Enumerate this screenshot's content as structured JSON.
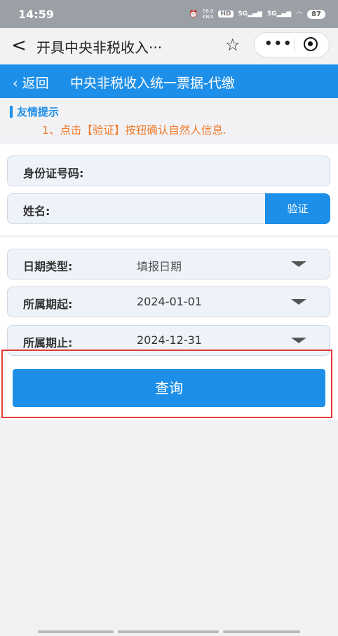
{
  "status": {
    "time": "14:59",
    "net_speed": "56.0",
    "net_unit": "KB/s",
    "hd": "HD",
    "sim1": "5G",
    "sim2": "5G",
    "battery": "87"
  },
  "appbar": {
    "title": "开具中央非税收入···"
  },
  "page_header": {
    "back_label": "返回",
    "title": "中央非税收入统一票据-代缴"
  },
  "tips": {
    "title": "友情提示",
    "text": "1、点击【验证】按钮确认自然人信息."
  },
  "form": {
    "id_label": "身份证号码:",
    "name_label": "姓名:",
    "verify_label": "验证",
    "date_type_label": "日期类型:",
    "date_type_value": "填报日期",
    "start_label": "所属期起:",
    "start_value": "2024-01-01",
    "end_label": "所属期止:",
    "end_value": "2024-12-31",
    "query_label": "查询"
  }
}
